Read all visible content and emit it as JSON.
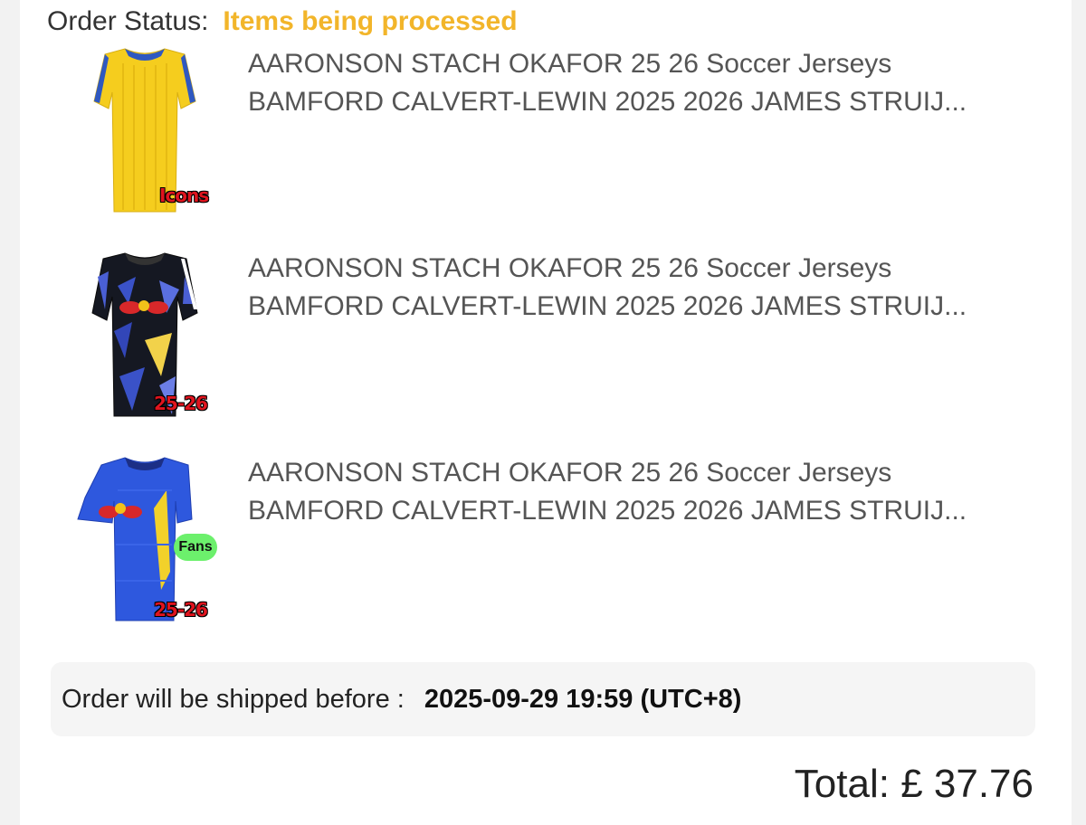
{
  "order": {
    "status_label": "Order Status:",
    "status_value": "Items being processed",
    "status_color": "#f2b52a"
  },
  "items": [
    {
      "title_line1": "AARONSON STACH OKAFOR 25 26 Soccer Jerseys",
      "title_line2": "BAMFORD CALVERT-LEWIN 2025 2026 JAMES STRUIJ...",
      "image_tag": "Icons",
      "image": "yellow-jersey"
    },
    {
      "title_line1": "AARONSON STACH OKAFOR 25 26 Soccer Jerseys",
      "title_line2": "BAMFORD CALVERT-LEWIN 2025 2026 JAMES STRUIJ...",
      "image_tag": "25-26",
      "image": "black-blue-jersey"
    },
    {
      "title_line1": "AARONSON STACH OKAFOR 25 26 Soccer Jerseys",
      "title_line2": "BAMFORD CALVERT-LEWIN 2025 2026 JAMES STRUIJ...",
      "image_tag": "25-26",
      "image_badge": "Fans",
      "image": "blue-jersey"
    }
  ],
  "shipping": {
    "label": "Order will be shipped before :",
    "value": "2025-09-29 19:59 (UTC+8)"
  },
  "total": {
    "text": "Total: £ 37.76"
  }
}
